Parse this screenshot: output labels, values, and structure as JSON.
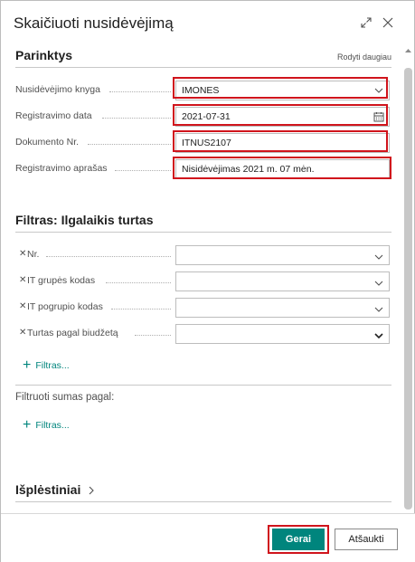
{
  "dialog": {
    "title": "Skaičiuoti nusidėvėjimą",
    "ok_label": "Gerai",
    "cancel_label": "Atšaukti"
  },
  "options": {
    "title": "Parinktys",
    "show_more": "Rodyti daugiau",
    "fields": [
      {
        "label": "Nusidėvėjimo knyga",
        "value": "IMONES"
      },
      {
        "label": "Registravimo data",
        "value": "2021-07-31"
      },
      {
        "label": "Dokumento Nr.",
        "value": "ITNUS2107"
      },
      {
        "label": "Registravimo aprašas",
        "value": "Nisidėvėjimas 2021 m. 07 mėn."
      }
    ]
  },
  "filter": {
    "title": "Filtras: Ilgalaikis turtas",
    "rows": [
      {
        "label": "Nr."
      },
      {
        "label": "IT grupės kodas"
      },
      {
        "label": "IT pogrupio kodas"
      },
      {
        "label": "Turtas pagal biudžetą"
      }
    ],
    "add_filter_label": "Filtras..."
  },
  "filter_totals": {
    "title": "Filtruoti sumas pagal:",
    "add_filter_label": "Filtras..."
  },
  "extensions": {
    "title": "Išplėstiniai"
  },
  "icons": {
    "expand": "expand-icon",
    "close": "close-icon",
    "calendar": "calendar-icon",
    "chevron": "chevron-down-icon",
    "remove": "close-x-icon",
    "add": "plus-icon"
  },
  "colors": {
    "accent": "#00857d",
    "highlight": "#d0141c"
  }
}
